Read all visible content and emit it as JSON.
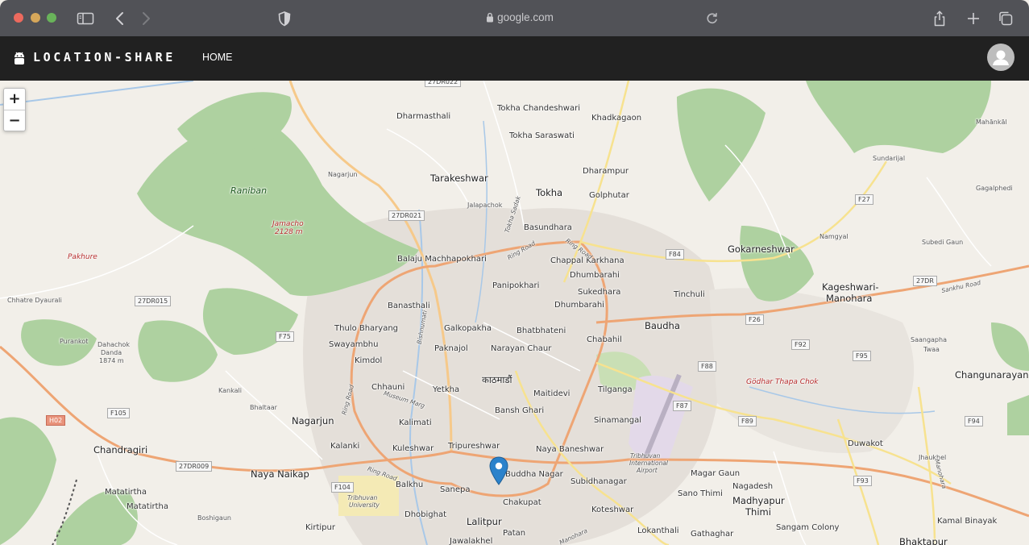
{
  "browser": {
    "url": "google.com"
  },
  "navbar": {
    "brand": "LOCATION-SHARE",
    "home_label": "HOME"
  },
  "map": {
    "zoom_in": "+",
    "zoom_out": "−",
    "labels": [
      "Tokha Chandeshwari",
      "Dharmasthali",
      "Khadkagaon",
      "Tokha Saraswati",
      "Mahānkāl",
      "Sundarijal",
      "Nagarjun",
      "Tarakeshwar",
      "Dharampur",
      "Raniban",
      "Jalapachok",
      "Tokha",
      "Golphutar",
      "Gagalphedi",
      "Jamacho",
      "2128 m",
      "Basundhara",
      "Namgyal",
      "Subedi Gaun",
      "Pakhure",
      "Balaju Machhapokhari",
      "Chappal Karkhana",
      "Dhumbarahi",
      "Gokarneshwar",
      "Panipokhari",
      "Sukedhara",
      "Tinchuli",
      "Kageshwari-",
      "Manohara",
      "Chhatre Dyaurali",
      "Banasthali",
      "Dhumbarahi",
      "Baudha",
      "Thulo Bharyang",
      "Galkopakha",
      "Bhatbhateni",
      "Swayambhu",
      "Paknajol",
      "Narayan Chaur",
      "Chabahil",
      "Saangapha",
      "Twaa",
      "Purankot",
      "Dahachok",
      "Danda",
      "1874 m",
      "Kimdol",
      "काठमाडौं",
      "Changunarayan",
      "Chhauni",
      "Yetkha",
      "Maitidevi",
      "Tilganga",
      "Gödhar Thapa Chok",
      "Kankali",
      "Bhaltaar",
      "Nagarjun",
      "Bansh Ghari",
      "Sinamangal",
      "Chandragiri",
      "Kalimati",
      "Kalanki",
      "Kuleshwar",
      "Tripureshwar",
      "Naya Baneshwar",
      "Duwakot",
      "Buddha Nagar",
      "Subidhanagar",
      "Jhaukhel",
      "Naya Naikap",
      "Balkhu",
      "Sanepa",
      "Magar Gaun",
      "Nagadesh",
      "Matatirtha",
      "Matatirtha",
      "Sano Thimi",
      "Madhyapur",
      "Thimi",
      "Boshigaun",
      "Chakupat",
      "Koteshwar",
      "Kirtipur",
      "Dhobighat",
      "Lalitpur",
      "Lokanthali",
      "Gathaghar",
      "Sangam Colony",
      "Kamal Binayak",
      "Patan",
      "Jawalakhel",
      "Bhaktapur",
      "Tribhuvan",
      "University",
      "Tribhuvan",
      "International",
      "Airport",
      "Museum Marg",
      "Ring Road",
      "Ring Road",
      "Ring Road",
      "Ring Road",
      "Sankhu Road",
      "Manohara",
      "Bishnumati",
      "Tokha Sadak",
      "Manohara"
    ],
    "shields": [
      "27DR022",
      "27DR021",
      "27DR015",
      "F75",
      "F84",
      "F27",
      "27DR",
      "F26",
      "F92",
      "F95",
      "F88",
      "F87",
      "F105",
      "H02",
      "27DR009",
      "F104",
      "F89",
      "F94",
      "F93"
    ]
  }
}
